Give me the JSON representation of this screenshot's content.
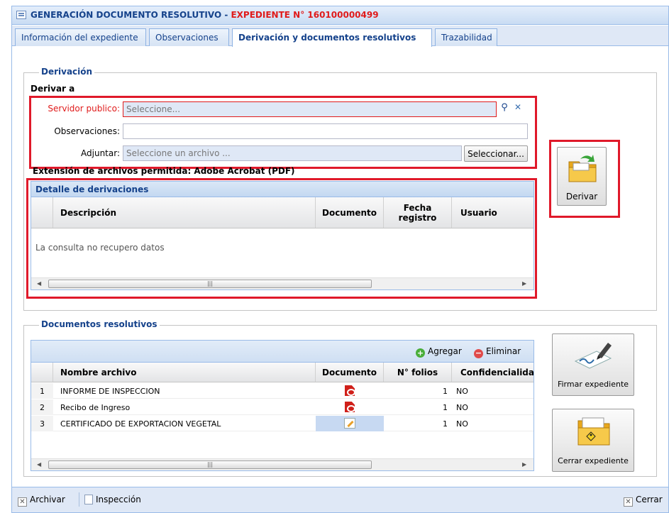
{
  "window": {
    "title_prefix": "GENERACIÓN DOCUMENTO RESOLUTIVO - ",
    "title_expediente": "EXPEDIENTE N° 160100000499"
  },
  "tabs": [
    {
      "label": "Información del expediente"
    },
    {
      "label": "Observaciones"
    },
    {
      "label": "Derivación y documentos resolutivos"
    },
    {
      "label": "Trazabilidad"
    }
  ],
  "derivacion": {
    "legend": "Derivación",
    "section_label": "Derivar a",
    "servidor_label": "Servidor publico:",
    "servidor_placeholder": "Seleccione...",
    "observaciones_label": "Observaciones:",
    "observaciones_value": "",
    "adjuntar_label": "Adjuntar:",
    "adjuntar_placeholder": "Seleccione un archivo ...",
    "seleccionar_button": "Seleccionar...",
    "extension_note": "Extensión de archivos permitida: Adobe Acrobat (PDF)",
    "derivar_button": "Derivar"
  },
  "detalle": {
    "title": "Detalle de derivaciones",
    "columns": [
      "Descripción",
      "Documento",
      "Fecha registro",
      "Usuario"
    ],
    "empty_text": "La consulta no recupero datos"
  },
  "documentos": {
    "legend": "Documentos resolutivos",
    "agregar": "Agregar",
    "eliminar": "Eliminar",
    "columns": [
      "Nombre archivo",
      "Documento",
      "N° folios",
      "Confidencialidad"
    ],
    "rows": [
      {
        "num": "1",
        "nombre": "INFORME DE INSPECCION",
        "doc_icon": "pdf-icon",
        "folios": "1",
        "conf": "NO"
      },
      {
        "num": "2",
        "nombre": "Recibo de Ingreso",
        "doc_icon": "pdf-icon",
        "folios": "1",
        "conf": "NO"
      },
      {
        "num": "3",
        "nombre": "CERTIFICADO DE EXPORTACION VEGETAL",
        "doc_icon": "edit-icon",
        "folios": "1",
        "conf": "NO"
      }
    ],
    "firmar_button": "Firmar expediente",
    "cerrar_button": "Cerrar expediente"
  },
  "bottom": {
    "archivar": "Archivar",
    "inspeccion": "Inspección",
    "cerrar": "Cerrar"
  },
  "colors": {
    "accent": "#15428b",
    "highlight_red": "#e0192a",
    "title_red": "#e01b1b",
    "panel_bg": "#dfe8f6"
  }
}
